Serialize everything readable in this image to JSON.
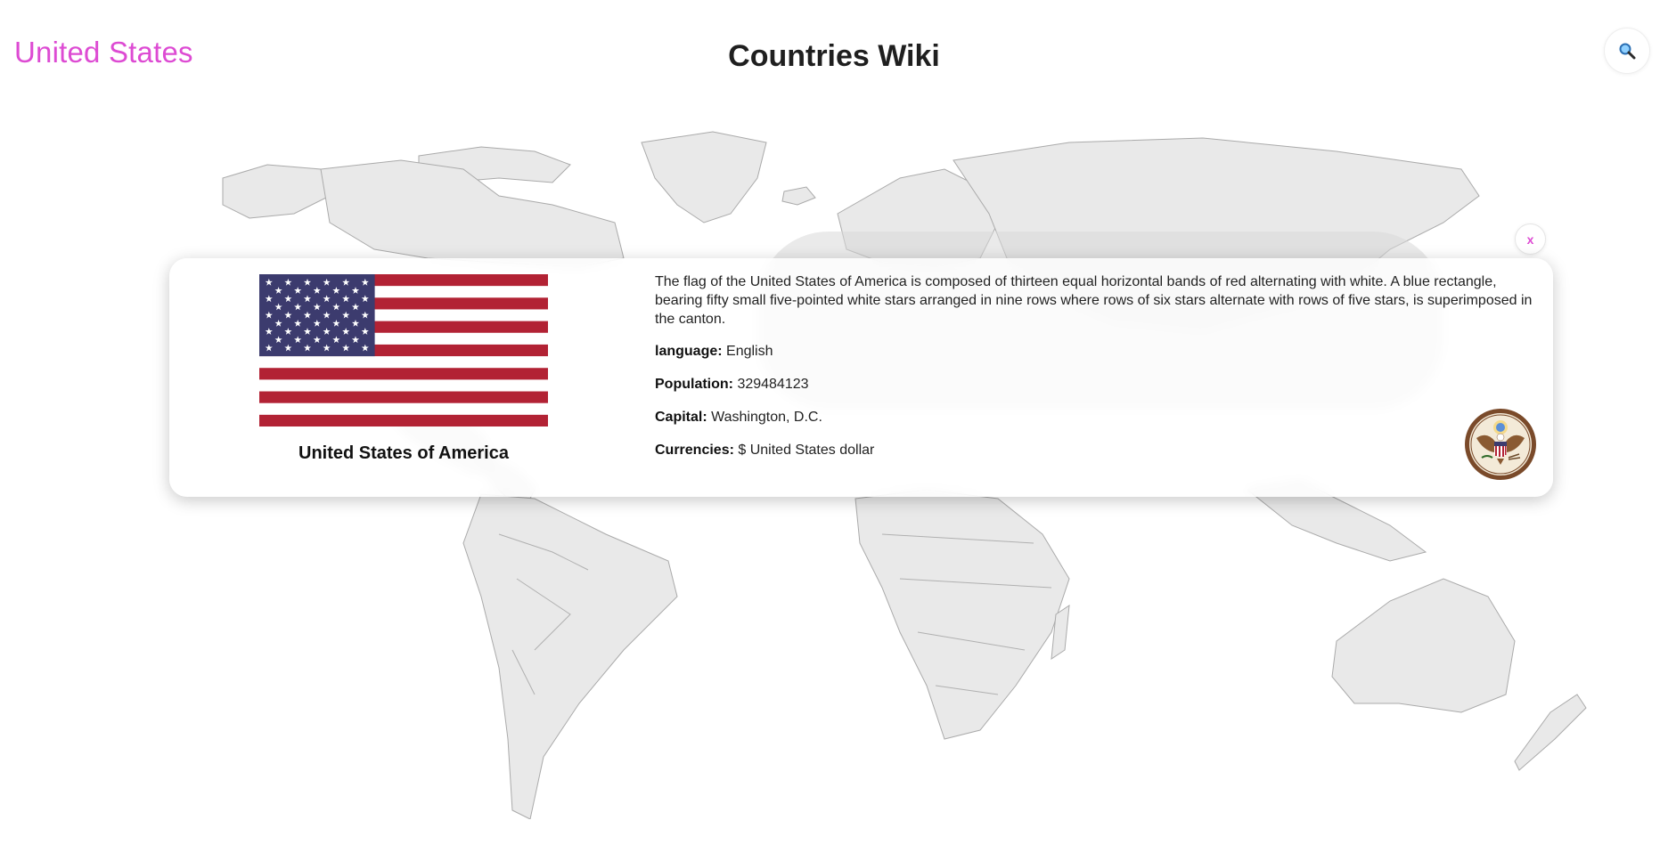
{
  "header": {
    "brand": "United States",
    "title": "Countries Wiki",
    "search_icon": "magnifier-icon"
  },
  "card": {
    "close_label": "x",
    "flag_icon": "us-flag",
    "country_official_name": "United States of America",
    "flag_description": "The flag of the United States of America is composed of thirteen equal horizontal bands of red alternating with white. A blue rectangle, bearing fifty small five-pointed white stars arranged in nine rows where rows of six stars alternate with rows of five stars, is superimposed in the canton.",
    "language_label": "language:",
    "language_value": "English",
    "population_label": "Population:",
    "population_value": "329484123",
    "capital_label": "Capital:",
    "capital_value": "Washington, D.C.",
    "currencies_label": "Currencies:",
    "currencies_value": "$ United States dollar",
    "seal_icon": "great-seal-emblem"
  },
  "colors": {
    "accent": "#dd4bd3",
    "flag_red": "#b22234",
    "flag_blue": "#3c3b6e",
    "map_land": "#e9e9e9"
  }
}
